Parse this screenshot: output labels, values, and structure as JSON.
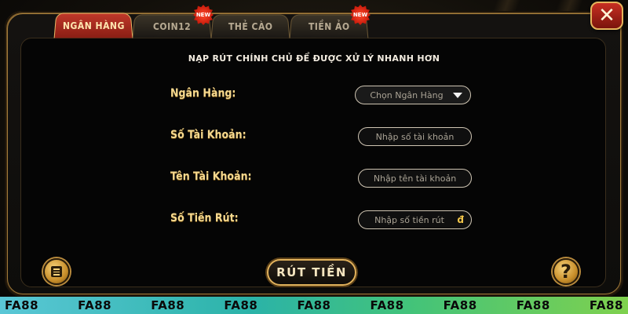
{
  "tabs": [
    {
      "label": "NGÂN HÀNG",
      "active": true,
      "new": false
    },
    {
      "label": "COIN12",
      "active": false,
      "new": true
    },
    {
      "label": "THẺ CÀO",
      "active": false,
      "new": false
    },
    {
      "label": "TIỀN ẢO",
      "active": false,
      "new": true
    }
  ],
  "badge_text": "NEW",
  "close_glyph": "✕",
  "heading": "NẠP RÚT CHÍNH CHỦ ĐỂ ĐƯỢC XỬ LÝ NHANH HƠN",
  "form": {
    "bank": {
      "label": "Ngân Hàng:",
      "value": "Chọn Ngân Hàng"
    },
    "account_number": {
      "label": "Số Tài Khoản:",
      "placeholder": "Nhập số tài  khoản"
    },
    "account_name": {
      "label": "Tên Tài Khoản:",
      "placeholder": "Nhập tên tài khoản"
    },
    "amount": {
      "label": "Số Tiền Rút:",
      "placeholder": "Nhập số tiền rút",
      "currency": "đ"
    }
  },
  "withdraw_button": "RÚT TIỀN",
  "help_glyph": "?",
  "icons": {
    "history": "list-icon",
    "help": "question-icon",
    "close": "close-icon",
    "dropdown": "caret-down-icon"
  },
  "footer_brand": "FA88",
  "colors": {
    "gold": "#f6d98f",
    "active_tab": "#c0382a",
    "border_gold": "#e2b25c"
  }
}
